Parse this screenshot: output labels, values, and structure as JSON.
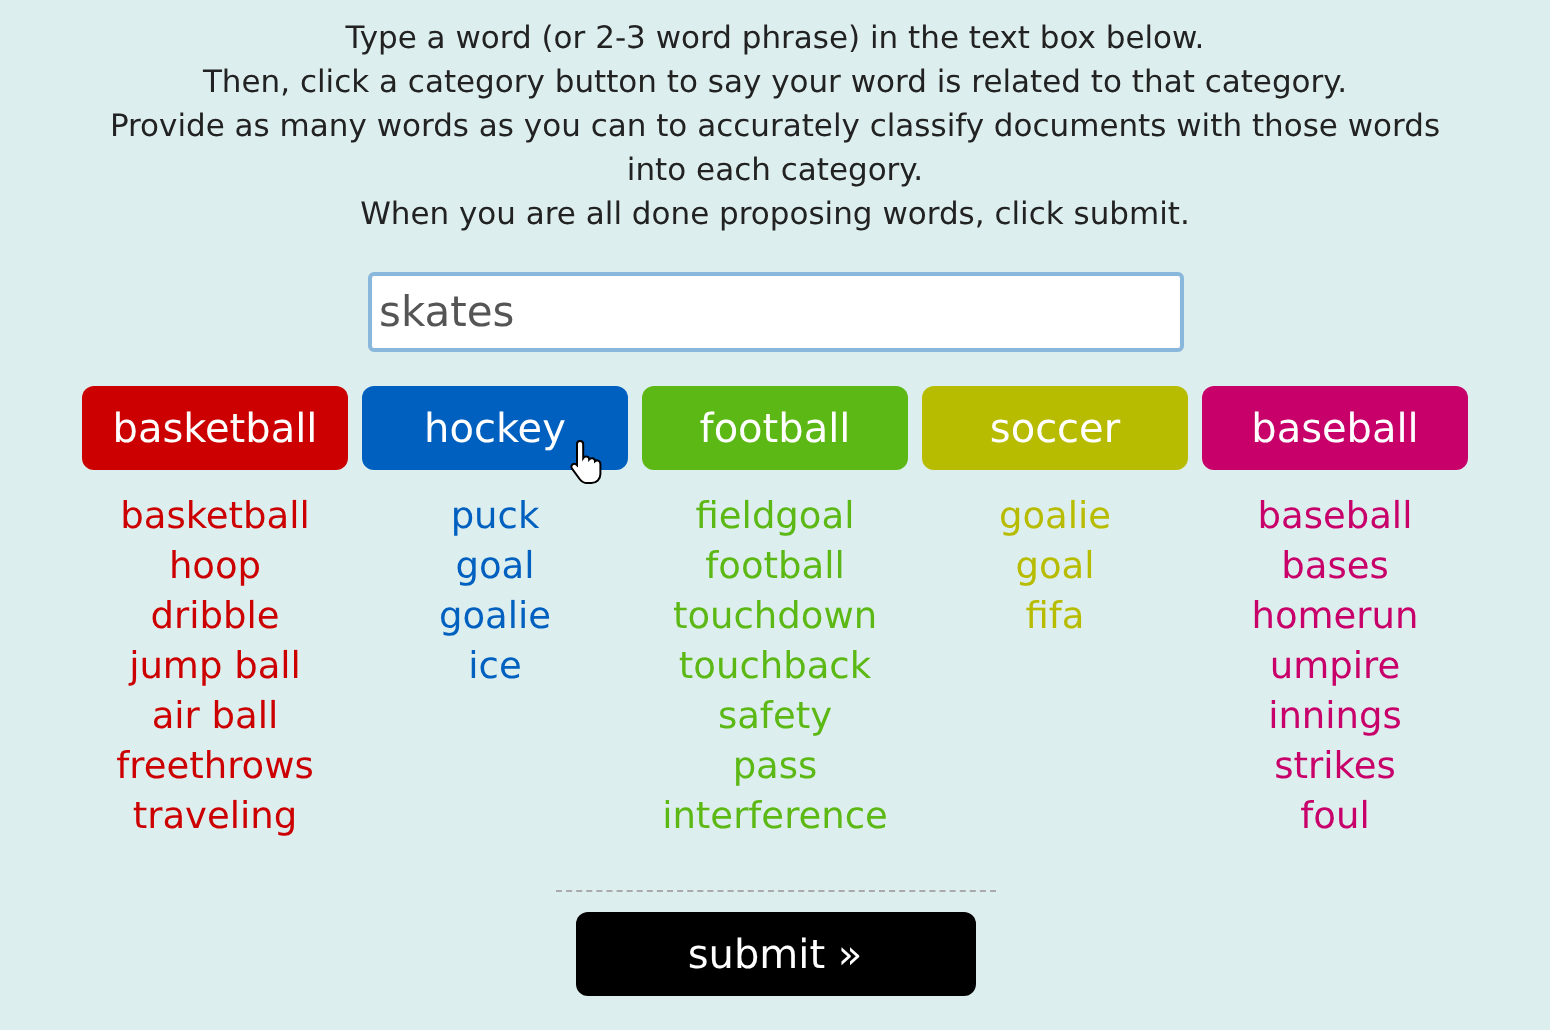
{
  "instructions": [
    "Type a word (or 2-3 word phrase) in the text box below.",
    "Then, click a category button to say your word is related to that category.",
    "Provide as many words as you can to accurately classify documents with those words",
    "into each category.",
    "When you are all done proposing words, click submit."
  ],
  "word_field": {
    "value": "skates"
  },
  "categories": [
    {
      "label": "basketball",
      "color": "#cc0000",
      "words": [
        "basketball",
        "hoop",
        "dribble",
        "jump ball",
        "air ball",
        "freethrows",
        "traveling"
      ]
    },
    {
      "label": "hockey",
      "color": "#0060c0",
      "words": [
        "puck",
        "goal",
        "goalie",
        "ice"
      ]
    },
    {
      "label": "football",
      "color": "#5cb814",
      "words": [
        "fieldgoal",
        "football",
        "touchdown",
        "touchback",
        "safety",
        "pass",
        "interference"
      ]
    },
    {
      "label": "soccer",
      "color": "#b8bc00",
      "words": [
        "goalie",
        "goal",
        "fifa"
      ]
    },
    {
      "label": "baseball",
      "color": "#c8006a",
      "words": [
        "baseball",
        "bases",
        "homerun",
        "umpire",
        "innings",
        "strikes",
        "foul"
      ]
    }
  ],
  "submit_button": "submit »"
}
